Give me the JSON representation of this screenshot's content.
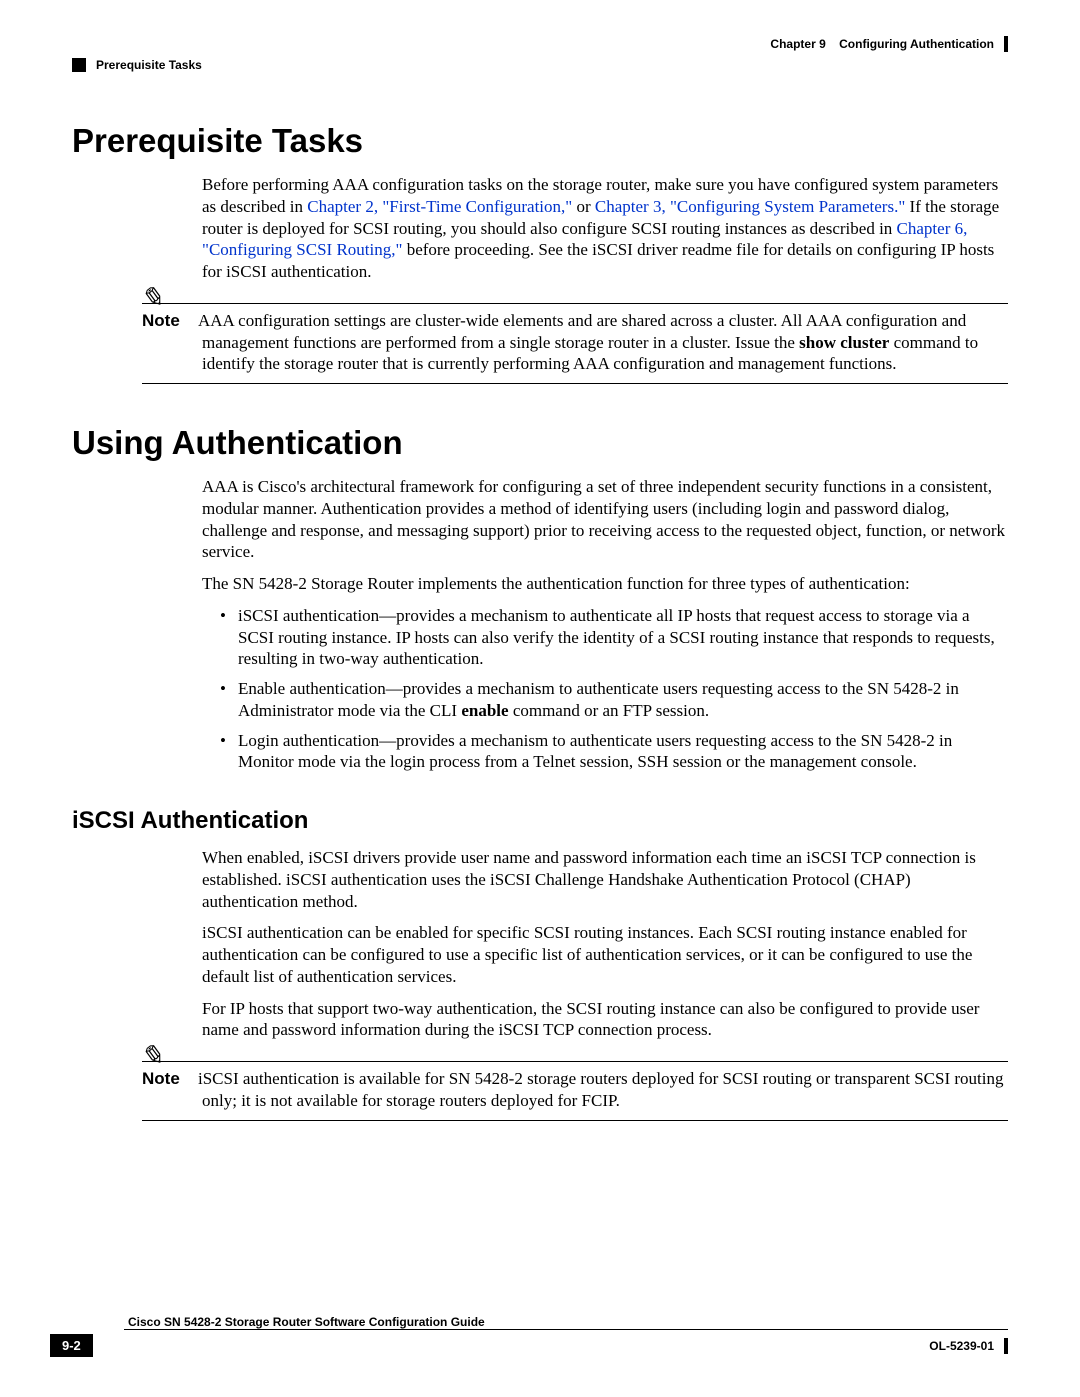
{
  "header": {
    "chapter_label": "Chapter 9",
    "chapter_title": "Configuring Authentication",
    "breadcrumb": "Prerequisite Tasks"
  },
  "sections": {
    "prereq": {
      "title": "Prerequisite Tasks",
      "para1_a": "Before performing AAA configuration tasks on the storage router, make sure you have configured system parameters as described in ",
      "link1": "Chapter 2, \"First-Time Configuration,\"",
      "para1_b": " or ",
      "link2": "Chapter 3, \"Configuring System Parameters.\"",
      "para1_c": " If the storage router is deployed for SCSI routing, you should also configure SCSI routing instances as described in ",
      "link3": "Chapter 6, \"Configuring SCSI Routing,\"",
      "para1_d": " before proceeding. See the iSCSI driver readme file for details on configuring IP hosts for iSCSI authentication.",
      "note_label": "Note",
      "note_a": "AAA configuration settings are cluster-wide elements and are shared across a cluster. All AAA configuration and management functions are performed from a single storage router in a cluster. Issue the ",
      "note_bold": "show cluster",
      "note_b": " command to identify the storage router that is currently performing AAA configuration and management functions."
    },
    "using_auth": {
      "title": "Using Authentication",
      "para1": "AAA is Cisco's architectural framework for configuring a set of three independent security functions in a consistent, modular manner. Authentication provides a method of identifying users (including login and password dialog, challenge and response, and messaging support) prior to receiving access to the requested object, function, or network service.",
      "para2": "The SN 5428-2 Storage Router implements the authentication function for three types of authentication:",
      "bullets": {
        "b1": "iSCSI authentication—provides a mechanism to authenticate all IP hosts that request access to storage via a SCSI routing instance. IP hosts can also verify the identity of a SCSI routing instance that responds to requests, resulting in two-way authentication.",
        "b2_a": "Enable authentication—provides a mechanism to authenticate users requesting access to the SN 5428-2 in Administrator mode via the CLI ",
        "b2_bold": "enable",
        "b2_b": " command or an FTP session.",
        "b3": "Login authentication—provides a mechanism to authenticate users requesting access to the SN 5428-2 in Monitor mode via the login process from a Telnet session, SSH session or the management console."
      }
    },
    "iscsi_auth": {
      "title": "iSCSI Authentication",
      "para1": "When enabled, iSCSI drivers provide user name and password information each time an iSCSI TCP connection is established. iSCSI authentication uses the iSCSI Challenge Handshake Authentication Protocol (CHAP) authentication method.",
      "para2": "iSCSI authentication can be enabled for specific SCSI routing instances. Each SCSI routing instance enabled for authentication can be configured to use a specific list of authentication services, or it can be configured to use the default list of authentication services.",
      "para3": "For IP hosts that support two-way authentication, the SCSI routing instance can also be configured to provide user name and password information during the iSCSI TCP connection process.",
      "note_label": "Note",
      "note": "iSCSI authentication is available for SN 5428-2 storage routers deployed for SCSI routing or transparent SCSI routing only; it is not available for storage routers deployed for FCIP."
    }
  },
  "footer": {
    "guide_title": "Cisco SN 5428-2 Storage Router Software Configuration Guide",
    "page_number": "9-2",
    "doc_number": "OL-5239-01"
  }
}
